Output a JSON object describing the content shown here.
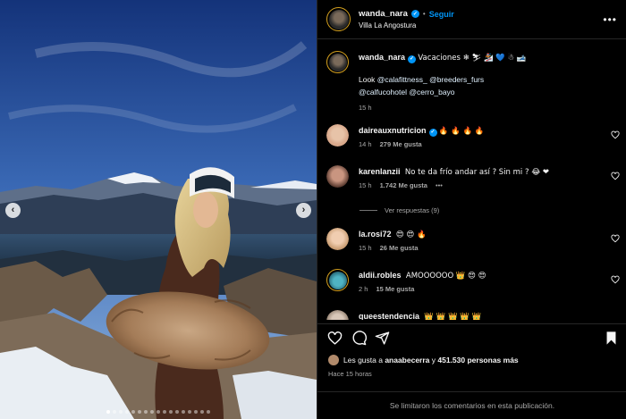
{
  "post": {
    "username": "wanda_nara",
    "follow_label": "Seguir",
    "separator": "•",
    "location": "Villa La Angostura",
    "more_label": "•••"
  },
  "caption": {
    "username": "wanda_nara",
    "text": "Vacaciones ❄ ⛷ 🏂 💙 ☃ 🎿",
    "look_prefix": "Look ",
    "tag1": "@calafittness_",
    "tag2": "@breeders_furs",
    "tag3": "@calfucohotel",
    "tag4": "@cerro_bayo",
    "time": "15 h"
  },
  "comments": [
    {
      "username": "daireauxnutricion",
      "verified": true,
      "text": "🔥 🔥 🔥 🔥",
      "time": "14 h",
      "likes": "279 Me gusta",
      "extra": ""
    },
    {
      "username": "karenlanzii",
      "verified": false,
      "text": "No te da frío andar así ? Sin mi ? 😂 ❤",
      "time": "15 h",
      "likes": "1.742 Me gusta",
      "extra": "•••"
    },
    {
      "username": "la.rosi72",
      "verified": false,
      "text": "😍 😍 🔥",
      "time": "15 h",
      "likes": "26 Me gusta",
      "extra": ""
    },
    {
      "username": "aldii.robles",
      "verified": false,
      "text": "AMOOOOOO 👑 😍 😍",
      "time": "2 h",
      "likes": "15 Me gusta",
      "extra": ""
    },
    {
      "username": "queestendencia",
      "verified": false,
      "text": "👑 👑 👑 👑 👑",
      "time": "",
      "likes": "",
      "extra": ""
    }
  ],
  "replies_label": "Ver respuestas (9)",
  "likes": {
    "prefix": "Les gusta a ",
    "user": "anaabecerra",
    "middle": " y ",
    "count": "451.530 personas más"
  },
  "time_ago": "Hace 15 horas",
  "footer_text": "Se limitaron los comentarios en esta publicación.",
  "carousel": {
    "total_dots": 17,
    "active_index": 0
  },
  "icons": [
    "chevron-left-icon",
    "chevron-right-icon",
    "heart-icon",
    "comment-icon",
    "share-icon",
    "bookmark-icon",
    "verified-icon"
  ],
  "colors": {
    "accent": "#0095f6",
    "background": "#000000",
    "secondary_text": "#a8a8a8"
  }
}
